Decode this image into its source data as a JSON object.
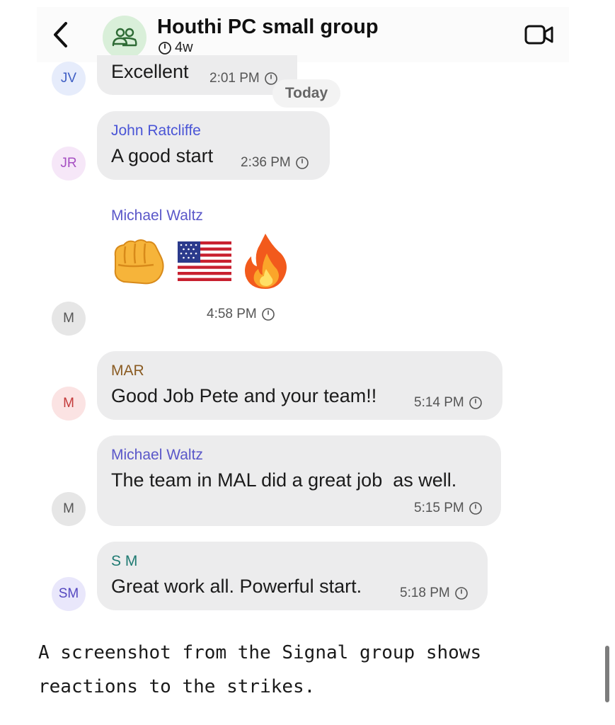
{
  "header": {
    "title": "Houthi PC small group",
    "timer": "4w",
    "icons": {
      "back": "chevron-left-icon",
      "group": "group-people-icon",
      "video": "video-call-icon",
      "timer": "timer-icon"
    }
  },
  "date_divider": "Today",
  "messages": [
    {
      "initials": "JV",
      "sender": "",
      "text": "Excellent",
      "time": "2:01 PM"
    },
    {
      "initials": "JR",
      "sender": "John Ratcliffe",
      "text": "A good start",
      "time": "2:36 PM"
    },
    {
      "initials": "M",
      "sender": "Michael Waltz",
      "text": "",
      "time": "4:58 PM",
      "emojis": [
        "oncoming-fist-emoji",
        "us-flag-emoji",
        "fire-emoji"
      ]
    },
    {
      "initials": "M",
      "sender": "MAR",
      "text": "Good Job Pete and your team!!",
      "time": "5:14 PM"
    },
    {
      "initials": "M",
      "sender": "Michael Waltz",
      "text": "The team in MAL did a great job  as well.",
      "time": "5:15 PM"
    },
    {
      "initials": "SM",
      "sender": "S M",
      "text": "Great work all. Powerful start.",
      "time": "5:18 PM"
    }
  ],
  "colors": {
    "bubble": "#ececed",
    "jv_text": "#3f5fc4",
    "jv_bg": "#e6ecfb",
    "jr_text": "#a64fc2",
    "jr_bg": "#f6e7f8",
    "m_text": "#555555",
    "m_bg": "#e6e6e6",
    "mar_text": "#c33a3a",
    "mar_bg": "#fbe3e3",
    "sm_text": "#5548c0",
    "sm_bg": "#e9e7fb",
    "name_ratcliffe": "#4a55d6",
    "name_waltz": "#5a57c9",
    "name_mar": "#8a5b22",
    "name_sm": "#1f7a72"
  },
  "caption": "A screenshot from the Signal group shows reactions to the strikes."
}
